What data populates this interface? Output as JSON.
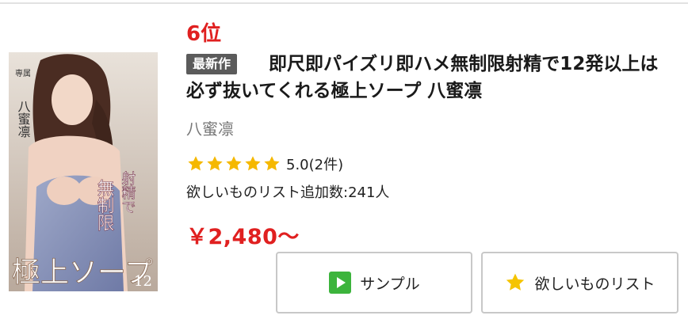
{
  "product": {
    "rank": "6位",
    "badge": "最新作",
    "title": "即尺即パイズリ即ハメ無制限射精で12発以上は必ず抜いてくれる極上ソープ 八蜜凛",
    "actress": "八蜜凛",
    "rating": {
      "value": 5.0,
      "stars_filled": 5,
      "stars_total": 5,
      "text": "5.0(2件)"
    },
    "wishlist": "欲しいものリスト追加数:241人",
    "price": "￥2,480〜"
  },
  "cover": {
    "alt_text_lines": [
      "専属",
      "八蜜凛",
      "無制限",
      "射精で",
      "極上ソープ",
      "12"
    ]
  },
  "buttons": {
    "sample_label": "サンプル",
    "wishlist_label": "欲しいものリスト"
  },
  "colors": {
    "accent_red": "#e02020",
    "badge_gray": "#5b5b5b",
    "star_gold": "#f5b800",
    "play_green": "#3cb43c"
  }
}
